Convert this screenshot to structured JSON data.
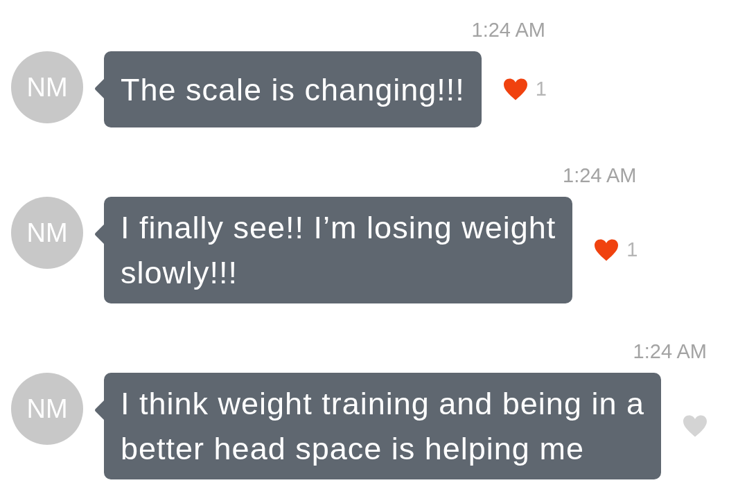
{
  "messages": [
    {
      "time": "1:24 AM",
      "avatar": "NM",
      "lines": [
        "The scale is changing!!!"
      ],
      "liked": true,
      "like_count": "1"
    },
    {
      "time": "1:24 AM",
      "avatar": "NM",
      "lines": [
        "I finally see!! I’m losing weight",
        "slowly!!!"
      ],
      "liked": true,
      "like_count": "1"
    },
    {
      "time": "1:24 AM",
      "avatar": "NM",
      "lines": [
        "I think weight training and being in a",
        "better head space is helping me"
      ],
      "liked": false
    }
  ]
}
